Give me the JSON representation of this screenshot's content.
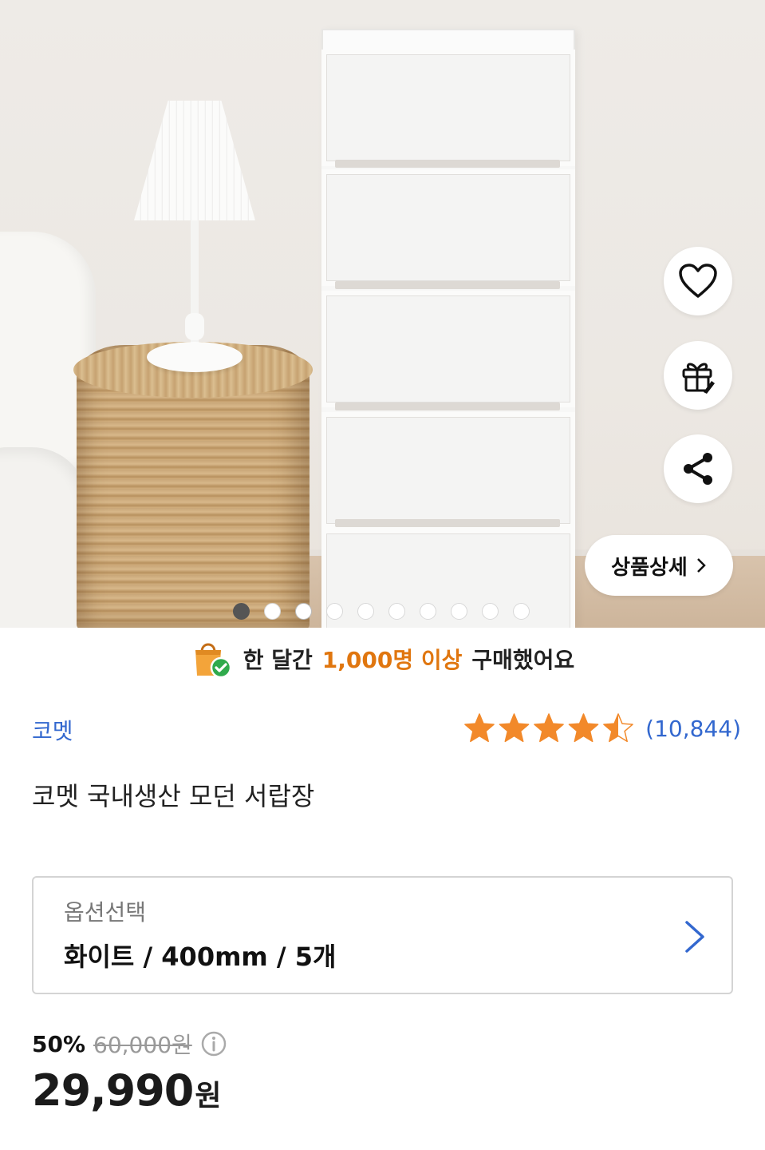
{
  "hero": {
    "detail_button_label": "상품상세",
    "carousel": {
      "total": 10,
      "active_index": 0
    }
  },
  "banner": {
    "prefix": "한 달간",
    "highlight": "1,000명 이상",
    "suffix": "구매했어요"
  },
  "product": {
    "brand": "코멧",
    "title": "코멧 국내생산 모던 서랍장",
    "rating": 4.5,
    "rating_count": "(10,844)"
  },
  "option": {
    "label": "옵션선택",
    "value": "화이트 / 400mm / 5개"
  },
  "price": {
    "discount": "50%",
    "original": "60,000원",
    "sale": "29,990",
    "currency": "원"
  },
  "colors": {
    "link_blue": "#3368cf",
    "highlight_orange": "#e0760f",
    "star_orange": "#f2892a"
  }
}
